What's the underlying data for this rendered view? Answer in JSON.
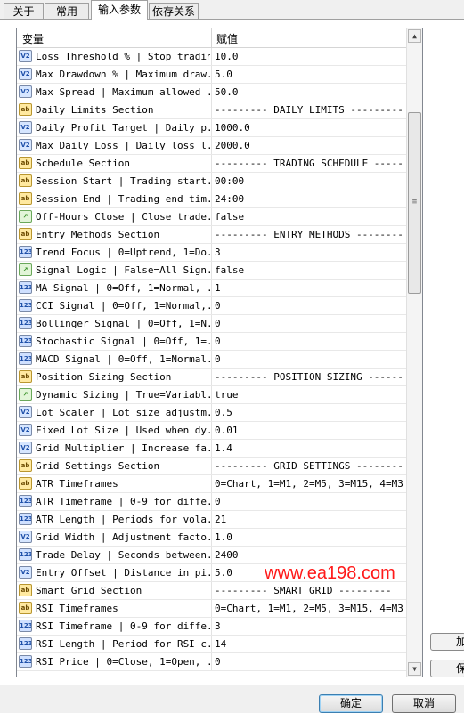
{
  "tabs": [
    {
      "label": "关于"
    },
    {
      "label": "常用"
    },
    {
      "label": "输入参数"
    },
    {
      "label": "依存关系"
    }
  ],
  "table": {
    "header": {
      "variable": "变量",
      "value": "赋值"
    },
    "rows": [
      {
        "icon": "v2",
        "name": "Loss Threshold % | Stop trading...",
        "value": "10.0"
      },
      {
        "icon": "v2",
        "name": "Max Drawdown % | Maximum draw...",
        "value": "5.0"
      },
      {
        "icon": "v2",
        "name": "Max Spread | Maximum allowed ...",
        "value": "50.0"
      },
      {
        "icon": "ab",
        "name": "Daily Limits Section",
        "value": "--------- DAILY LIMITS ---------"
      },
      {
        "icon": "v2",
        "name": "Daily Profit Target | Daily p...",
        "value": "1000.0"
      },
      {
        "icon": "v2",
        "name": "Max Daily Loss | Daily loss l...",
        "value": "2000.0"
      },
      {
        "icon": "ab",
        "name": "Schedule Section",
        "value": "--------- TRADING SCHEDULE -----..."
      },
      {
        "icon": "ab",
        "name": "Session Start | Trading start...",
        "value": "00:00"
      },
      {
        "icon": "ab",
        "name": "Session End | Trading end tim...",
        "value": "24:00"
      },
      {
        "icon": "bool",
        "name": "Off-Hours Close | Close trade...",
        "value": "false"
      },
      {
        "icon": "ab",
        "name": "Entry Methods Section",
        "value": "--------- ENTRY METHODS ---------"
      },
      {
        "icon": "123",
        "name": "Trend Focus | 0=Uptrend, 1=Do...",
        "value": "3"
      },
      {
        "icon": "bool",
        "name": "Signal Logic | False=All Sign...",
        "value": "false"
      },
      {
        "icon": "123",
        "name": "MA Signal | 0=Off, 1=Normal, ...",
        "value": "1"
      },
      {
        "icon": "123",
        "name": "CCI Signal | 0=Off, 1=Normal,...",
        "value": "0"
      },
      {
        "icon": "123",
        "name": "Bollinger Signal | 0=Off, 1=N...",
        "value": "0"
      },
      {
        "icon": "123",
        "name": "Stochastic Signal | 0=Off, 1=...",
        "value": "0"
      },
      {
        "icon": "123",
        "name": "MACD Signal | 0=Off, 1=Normal...",
        "value": "0"
      },
      {
        "icon": "ab",
        "name": "Position Sizing Section",
        "value": "--------- POSITION SIZING ---------"
      },
      {
        "icon": "bool",
        "name": "Dynamic Sizing | True=Variabl...",
        "value": "true"
      },
      {
        "icon": "v2",
        "name": "Lot Scaler | Lot size adjustm...",
        "value": "0.5"
      },
      {
        "icon": "v2",
        "name": "Fixed Lot Size | Used when dy...",
        "value": "0.01"
      },
      {
        "icon": "v2",
        "name": "Grid Multiplier | Increase fa...",
        "value": "1.4"
      },
      {
        "icon": "ab",
        "name": "Grid Settings Section",
        "value": "--------- GRID SETTINGS ---------"
      },
      {
        "icon": "ab",
        "name": "ATR Timeframes",
        "value": "0=Chart, 1=M1, 2=M5, 3=M15, 4=M3..."
      },
      {
        "icon": "123",
        "name": "ATR Timeframe | 0-9 for diffe...",
        "value": "0"
      },
      {
        "icon": "123",
        "name": "ATR Length | Periods for vola...",
        "value": "21"
      },
      {
        "icon": "v2",
        "name": "Grid Width | Adjustment facto...",
        "value": "1.0"
      },
      {
        "icon": "123",
        "name": "Trade Delay | Seconds between...",
        "value": "2400"
      },
      {
        "icon": "v2",
        "name": "Entry Offset | Distance in pi...",
        "value": "5.0"
      },
      {
        "icon": "ab",
        "name": "Smart Grid Section",
        "value": "--------- SMART GRID ---------"
      },
      {
        "icon": "ab",
        "name": "RSI Timeframes",
        "value": "0=Chart, 1=M1, 2=M5, 3=M15, 4=M3..."
      },
      {
        "icon": "123",
        "name": "RSI Timeframe | 0-9 for diffe...",
        "value": "3"
      },
      {
        "icon": "123",
        "name": "RSI Length | Period for RSI c...",
        "value": "14"
      },
      {
        "icon": "123",
        "name": "RSI Price | 0=Close, 1=Open, ...",
        "value": "0"
      }
    ]
  },
  "icon_labels": {
    "v2": "V2",
    "ab": "ab",
    "123": "123",
    "bool": "↗"
  },
  "side_buttons": [
    {
      "label": "加"
    },
    {
      "label": "保"
    }
  ],
  "buttons": {
    "ok": "确定",
    "cancel": "取消"
  },
  "watermark": "www.ea198.com",
  "colors": {
    "watermark": "#ff1a1a",
    "bg": "#f0f0f0"
  }
}
